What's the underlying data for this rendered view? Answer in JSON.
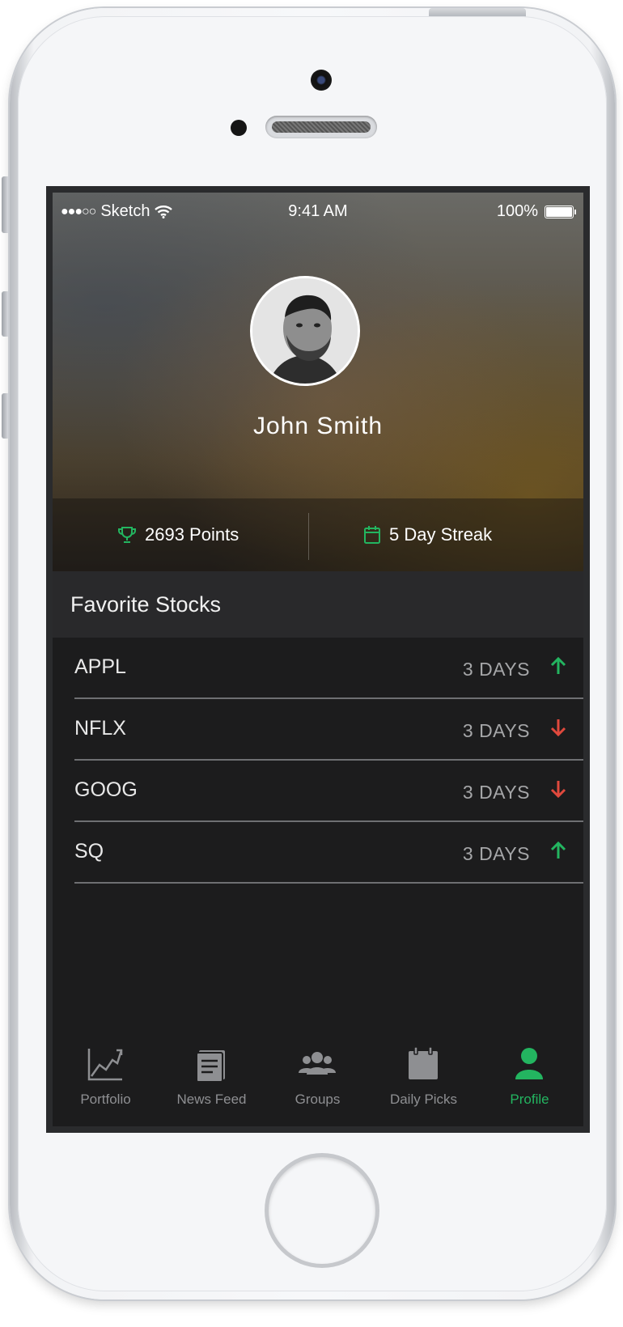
{
  "status_bar": {
    "signal": "●●●○○",
    "carrier": "Sketch",
    "time": "9:41 AM",
    "battery": "100%"
  },
  "profile": {
    "name": "John Smith",
    "points": "2693 Points",
    "streak": "5 Day Streak"
  },
  "favorites": {
    "title": "Favorite Stocks",
    "stocks": [
      {
        "symbol": "APPL",
        "duration": "3 DAYS",
        "direction": "up"
      },
      {
        "symbol": "NFLX",
        "duration": "3 DAYS",
        "direction": "down"
      },
      {
        "symbol": "GOOG",
        "duration": "3 DAYS",
        "direction": "down"
      },
      {
        "symbol": "SQ",
        "duration": "3 DAYS",
        "direction": "up"
      }
    ]
  },
  "tabs": [
    {
      "label": "Portfolio",
      "icon": "chart-line-icon"
    },
    {
      "label": "News Feed",
      "icon": "newspaper-icon"
    },
    {
      "label": "Groups",
      "icon": "group-icon"
    },
    {
      "label": "Daily Picks",
      "icon": "calendar-icon"
    },
    {
      "label": "Profile",
      "icon": "person-icon",
      "active": true
    }
  ],
  "colors": {
    "accent": "#23b560",
    "up": "#23b560",
    "down": "#e0493d",
    "background": "#1c1c1d"
  }
}
